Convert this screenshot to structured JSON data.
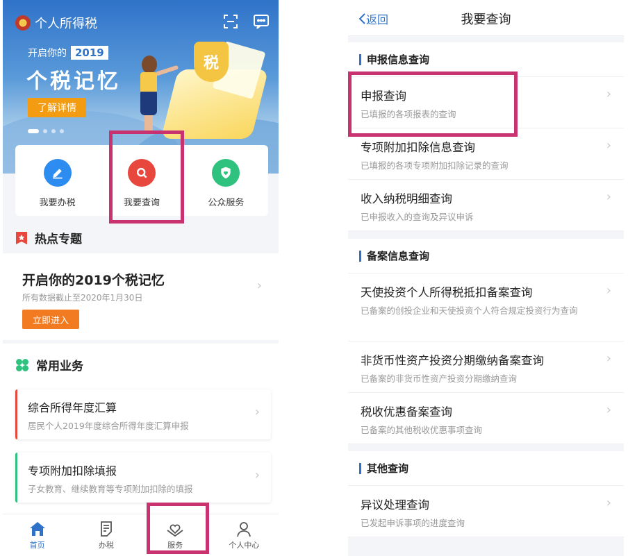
{
  "left": {
    "app_title": "个人所得税",
    "banner": {
      "kicker": "开启你的",
      "year": "2019",
      "title": "个税记忆",
      "button": "了解详情",
      "badge": "税"
    },
    "quick": [
      {
        "label": "我要办税",
        "color": "#2d8cf0",
        "icon": "pen-icon"
      },
      {
        "label": "我要查询",
        "color": "#e8473d",
        "icon": "search-icon"
      },
      {
        "label": "公众服务",
        "color": "#2ec27e",
        "icon": "shield-heart-icon"
      }
    ],
    "hot": {
      "heading": "热点专题",
      "title": "开启你的2019个税记忆",
      "subtitle": "所有数据截止至2020年1月30日",
      "button": "立即进入"
    },
    "common": {
      "heading": "常用业务",
      "items": [
        {
          "title": "综合所得年度汇算",
          "subtitle": "居民个人2019年度综合所得年度汇算申报",
          "accent": "#e8473d"
        },
        {
          "title": "专项附加扣除填报",
          "subtitle": "子女教育、继续教育等专项附加扣除的填报",
          "accent": "#2ec27e"
        }
      ]
    },
    "tabs": [
      {
        "label": "首页",
        "icon": "home-icon"
      },
      {
        "label": "办税",
        "icon": "document-icon"
      },
      {
        "label": "服务",
        "icon": "heart-hands-icon"
      },
      {
        "label": "个人中心",
        "icon": "person-icon"
      }
    ]
  },
  "right": {
    "back": "返回",
    "title": "我要查询",
    "groups": [
      {
        "heading": "申报信息查询",
        "rows": [
          {
            "title": "申报查询",
            "subtitle": "已填报的各项报表的查询"
          },
          {
            "title": "专项附加扣除信息查询",
            "subtitle": "已填报的各项专项附加扣除记录的查询"
          },
          {
            "title": "收入纳税明细查询",
            "subtitle": "已申报收入的查询及异议申诉"
          }
        ]
      },
      {
        "heading": "备案信息查询",
        "rows": [
          {
            "title": "天使投资个人所得税抵扣备案查询",
            "subtitle": "已备案的创投企业和天使投资个人符合规定投资行为查询"
          },
          {
            "title": "非货币性资产投资分期缴纳备案查询",
            "subtitle": "已备案的非货币性资产投资分期缴纳查询"
          },
          {
            "title": "税收优惠备案查询",
            "subtitle": "已备案的其他税收优惠事项查询"
          }
        ]
      },
      {
        "heading": "其他查询",
        "rows": [
          {
            "title": "异议处理查询",
            "subtitle": "已发起申诉事项的进度查询"
          }
        ]
      }
    ]
  },
  "colors": {
    "primary": "#2f73c9",
    "highlight": "#c8326f",
    "orange": "#f27b22"
  }
}
